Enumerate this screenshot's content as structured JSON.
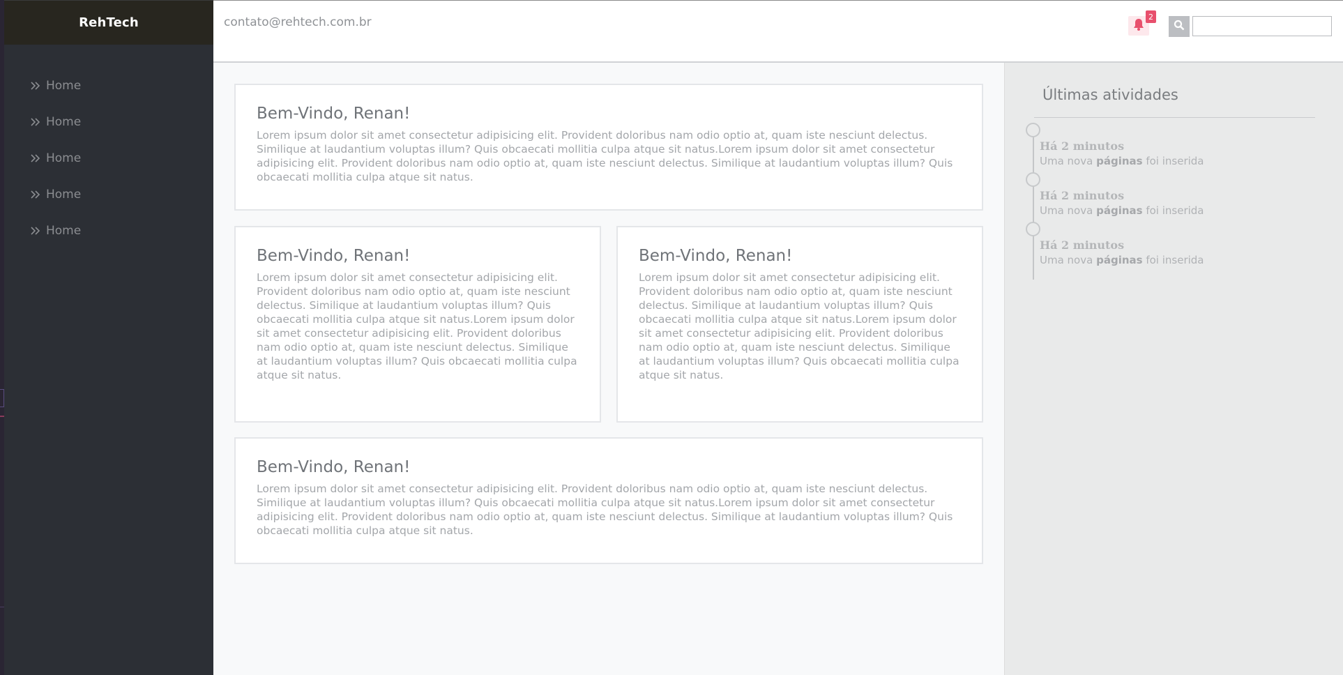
{
  "brand": {
    "name": "RehTech"
  },
  "sidebar": {
    "items": [
      {
        "label": "Home",
        "icon": "double-chevron-right-icon"
      },
      {
        "label": "Home",
        "icon": "double-chevron-right-icon"
      },
      {
        "label": "Home",
        "icon": "double-chevron-right-icon"
      },
      {
        "label": "Home",
        "icon": "double-chevron-right-icon"
      },
      {
        "label": "Home",
        "icon": "double-chevron-right-icon"
      }
    ]
  },
  "header": {
    "email": "contato@rehtech.com.br",
    "notifications": {
      "count": "2",
      "icon": "bell-icon"
    },
    "search": {
      "icon": "search-icon",
      "value": "",
      "placeholder": ""
    }
  },
  "cards": [
    {
      "title": "Bem-Vindo, Renan!",
      "text": "Lorem ipsum dolor sit amet consectetur adipisicing elit. Provident doloribus nam odio optio at, quam iste nesciunt delectus. Similique at laudantium voluptas illum? Quis obcaecati mollitia culpa atque sit natus.Lorem ipsum dolor sit amet consectetur adipisicing elit. Provident doloribus nam odio optio at, quam iste nesciunt delectus. Similique at laudantium voluptas illum? Quis obcaecati mollitia culpa atque sit natus."
    },
    {
      "title": "Bem-Vindo, Renan!",
      "text": "Lorem ipsum dolor sit amet consectetur adipisicing elit. Provident doloribus nam odio optio at, quam iste nesciunt delectus. Similique at laudantium voluptas illum? Quis obcaecati mollitia culpa atque sit natus.Lorem ipsum dolor sit amet consectetur adipisicing elit. Provident doloribus nam odio optio at, quam iste nesciunt delectus. Similique at laudantium voluptas illum? Quis obcaecati mollitia culpa atque sit natus."
    },
    {
      "title": "Bem-Vindo, Renan!",
      "text": "Lorem ipsum dolor sit amet consectetur adipisicing elit. Provident doloribus nam odio optio at, quam iste nesciunt delectus. Similique at laudantium voluptas illum? Quis obcaecati mollitia culpa atque sit natus.Lorem ipsum dolor sit amet consectetur adipisicing elit. Provident doloribus nam odio optio at, quam iste nesciunt delectus. Similique at laudantium voluptas illum? Quis obcaecati mollitia culpa atque sit natus."
    },
    {
      "title": "Bem-Vindo, Renan!",
      "text": "Lorem ipsum dolor sit amet consectetur adipisicing elit. Provident doloribus nam odio optio at, quam iste nesciunt delectus. Similique at laudantium voluptas illum? Quis obcaecati mollitia culpa atque sit natus.Lorem ipsum dolor sit amet consectetur adipisicing elit. Provident doloribus nam odio optio at, quam iste nesciunt delectus. Similique at laudantium voluptas illum? Quis obcaecati mollitia culpa atque sit natus."
    }
  ],
  "activity": {
    "title": "Últimas atividades",
    "items": [
      {
        "time": "Há 2 minutos",
        "prefix": "Uma nova",
        "highlight": "páginas",
        "suffix": "foi inserida"
      },
      {
        "time": "Há 2 minutos",
        "prefix": "Uma nova",
        "highlight": "páginas",
        "suffix": "foi inserida"
      },
      {
        "time": "Há 2 minutos",
        "prefix": "Uma nova",
        "highlight": "páginas",
        "suffix": "foi inserida"
      }
    ]
  },
  "colors": {
    "sidebar_bg": "#2c2f35",
    "brand_bg": "#28261f",
    "accent_notification": "#e8506d",
    "main_bg": "#f8f9fa",
    "panel_bg": "#e9eaea"
  }
}
